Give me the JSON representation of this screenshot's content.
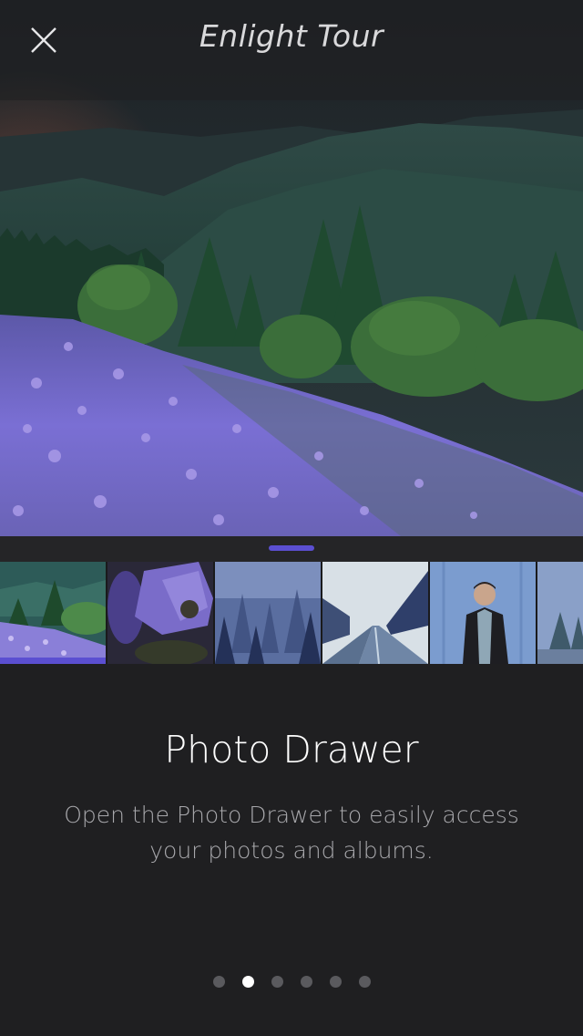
{
  "header": {
    "title": "Enlight Tour",
    "close_icon": "close-icon"
  },
  "colors": {
    "background": "#1f1f21",
    "accent": "#5b4fd1"
  },
  "drawer": {
    "handle_icon": "drawer-handle",
    "thumbnails": [
      {
        "name": "thumb-lupine-meadow",
        "selected": true
      },
      {
        "name": "thumb-purple-flower",
        "selected": false
      },
      {
        "name": "thumb-misty-forest",
        "selected": false
      },
      {
        "name": "thumb-wet-road",
        "selected": false
      },
      {
        "name": "thumb-man-blue-wall",
        "selected": false
      },
      {
        "name": "thumb-foggy-trees",
        "selected": false
      }
    ]
  },
  "content": {
    "heading": "Photo Drawer",
    "description": "Open the Photo Drawer to easily access your photos and albums."
  },
  "pagination": {
    "count": 6,
    "active_index": 1
  }
}
